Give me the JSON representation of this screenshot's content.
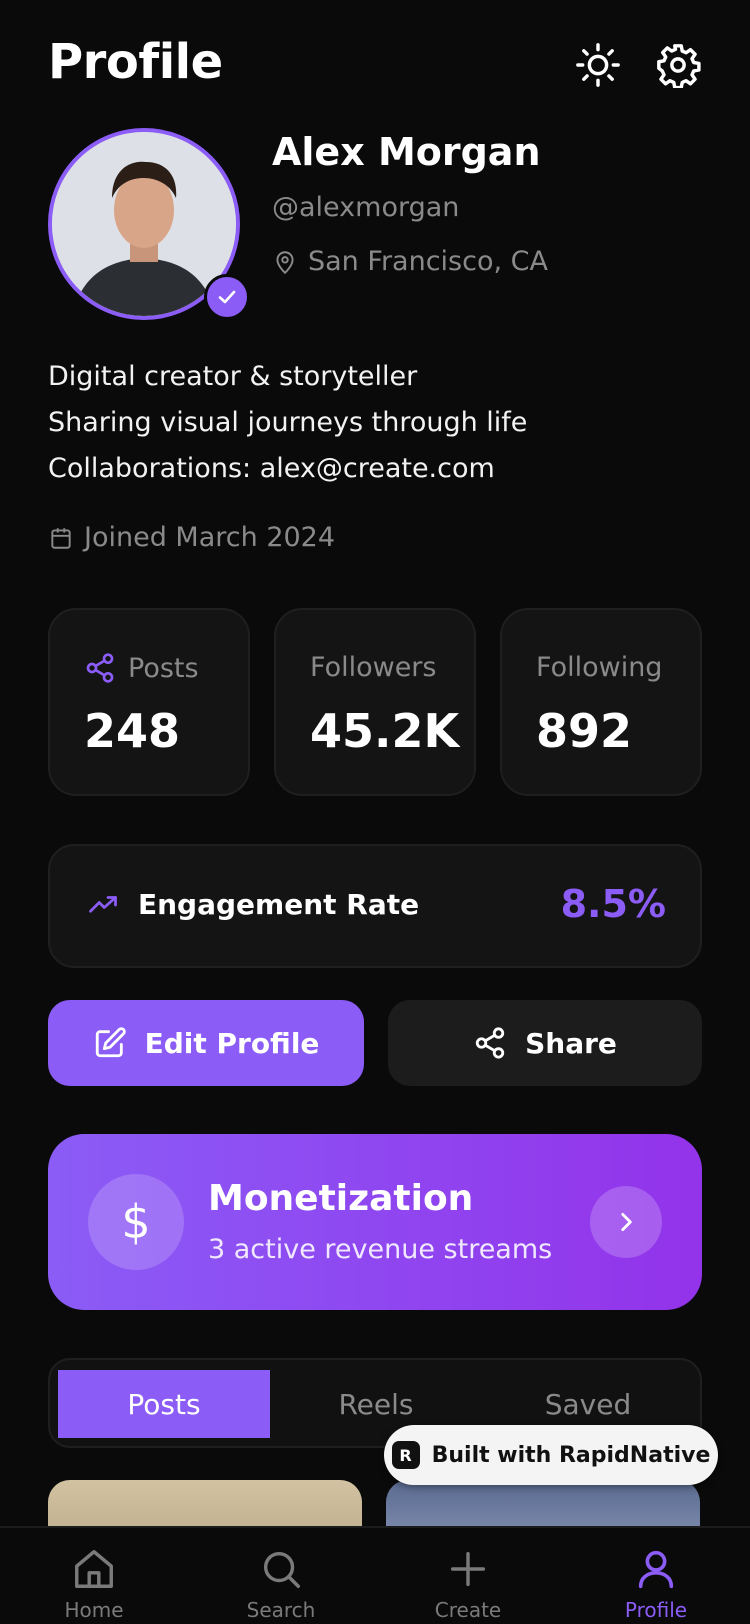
{
  "header": {
    "title": "Profile"
  },
  "profile": {
    "name": "Alex Morgan",
    "handle": "@alexmorgan",
    "location": "San Francisco, CA",
    "bio": [
      "Digital creator & storyteller",
      "Sharing visual journeys through life",
      "Collaborations: alex@create.com"
    ],
    "joined": "Joined March 2024"
  },
  "stats": [
    {
      "label": "Posts",
      "value": "248"
    },
    {
      "label": "Followers",
      "value": "45.2K"
    },
    {
      "label": "Following",
      "value": "892"
    }
  ],
  "engagement": {
    "label": "Engagement Rate",
    "value": "8.5%"
  },
  "actions": {
    "edit": "Edit Profile",
    "share": "Share"
  },
  "monetization": {
    "title": "Monetization",
    "subtitle": "3 active revenue streams",
    "symbol": "$"
  },
  "tabs": [
    "Posts",
    "Reels",
    "Saved"
  ],
  "badge": {
    "text": "Built with RapidNative"
  },
  "nav": [
    "Home",
    "Search",
    "Create",
    "Profile"
  ],
  "colors": {
    "accent": "#8b5cf6",
    "background": "#0a0a0a",
    "card": "#141414"
  },
  "icons": {
    "theme": "sun-icon",
    "settings": "gear-icon",
    "verified": "check-icon",
    "location": "map-pin-icon",
    "calendar": "calendar-icon",
    "share": "share-icon",
    "trend": "trending-up-icon",
    "edit": "edit-icon",
    "arrow": "chevron-right-icon"
  }
}
